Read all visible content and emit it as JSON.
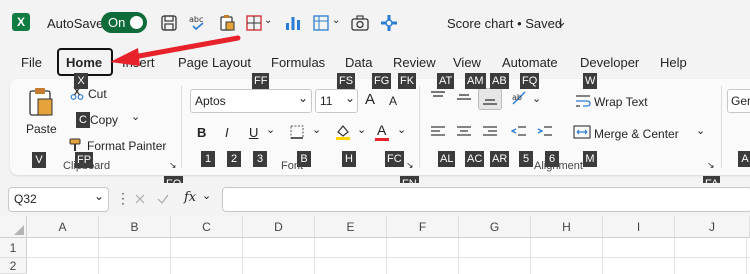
{
  "titlebar": {
    "logo_letter": "X",
    "autosave_label": "AutoSave",
    "autosave_state": "On",
    "doc_title": "Score chart • Saved",
    "quick_access_icons": [
      "save-icon",
      "spelling-icon",
      "paste-special-icon",
      "borders-icon",
      "chart-icon",
      "pivot-icon",
      "camera-icon",
      "move-icon"
    ]
  },
  "tabs": [
    "File",
    "Home",
    "Insert",
    "Page Layout",
    "Formulas",
    "Data",
    "Review",
    "View",
    "Automate",
    "Developer",
    "Help"
  ],
  "ribbon": {
    "clipboard": {
      "paste_label": "Paste",
      "cut_label": "Cut",
      "copy_label": "Copy",
      "format_painter_label": "Format Painter",
      "group_label": "Clipboard"
    },
    "font": {
      "font_name": "Aptos",
      "font_size": "11",
      "grow_glyph": "A",
      "shrink_glyph": "A",
      "bold": "B",
      "italic": "I",
      "underline": "U",
      "font_color_glyph": "A",
      "group_label": "Font"
    },
    "alignment": {
      "wrap_text_label": "Wrap Text",
      "merge_center_label": "Merge & Center",
      "group_label": "Alignment"
    },
    "number": {
      "format_value": "Gen"
    }
  },
  "keytips": {
    "home": "H",
    "file_x": "X",
    "insert_c": "C",
    "copy_c": "C",
    "v": "V",
    "fp": "FP",
    "fo": "FO",
    "ff": "FF",
    "fs": "FS",
    "fg": "FG",
    "fk": "FK",
    "at": "AT",
    "am": "AM",
    "ab": "AB",
    "fq": "FQ",
    "w": "W",
    "b1": "1",
    "b2": "2",
    "b3": "3",
    "b": "B",
    "h": "H",
    "fc": "FC",
    "fn": "FN",
    "al": "AL",
    "ac": "AC",
    "ar": "AR",
    "k5": "5",
    "k6": "6",
    "m": "M",
    "fa": "FA",
    "a": "A"
  },
  "formula_bar": {
    "name_box": "Q32",
    "fx": "fx",
    "value": ""
  },
  "grid": {
    "columns": [
      "A",
      "B",
      "C",
      "D",
      "E",
      "F",
      "G",
      "H",
      "I",
      "J"
    ],
    "rows": [
      "1",
      "2"
    ]
  },
  "annotation": {
    "arrow_color": "#e8222a"
  }
}
